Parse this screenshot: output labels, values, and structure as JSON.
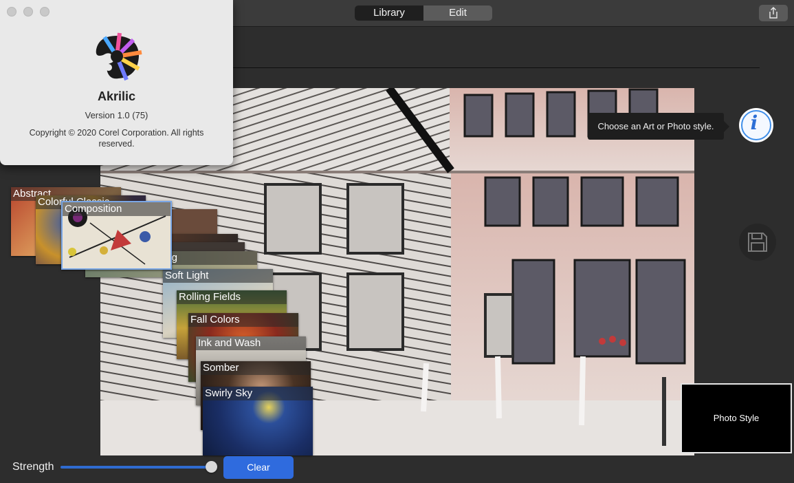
{
  "toolbar": {
    "tabs": [
      {
        "label": "Library",
        "active": true
      },
      {
        "label": "Edit",
        "active": false
      }
    ],
    "share_icon": "share-icon"
  },
  "canvas": {
    "tooltip": "Choose an Art or Photo style.",
    "info_icon": "info-icon",
    "info_glyph": "i",
    "save_icon": "floppy-disk-icon"
  },
  "styles": [
    {
      "label": "Abstract"
    },
    {
      "label": "Colorful Classic"
    },
    {
      "label": "Composition",
      "selected": true
    },
    {
      "label": ""
    },
    {
      "label": ""
    },
    {
      "label": "Morning"
    },
    {
      "label": "Soft Light"
    },
    {
      "label": "Rolling Fields"
    },
    {
      "label": "Fall Colors"
    },
    {
      "label": "Ink and Wash"
    },
    {
      "label": "Somber"
    },
    {
      "label": "Swirly Sky"
    }
  ],
  "style_preview": {
    "label": "Photo Style"
  },
  "bottom": {
    "strength_label": "Strength",
    "strength_value": 1.0,
    "clear_label": "Clear"
  },
  "about": {
    "app_name": "Akrilic",
    "version": "Version 1.0 (75)",
    "copyright": "Copyright © 2020 Corel Corporation. All rights reserved."
  }
}
